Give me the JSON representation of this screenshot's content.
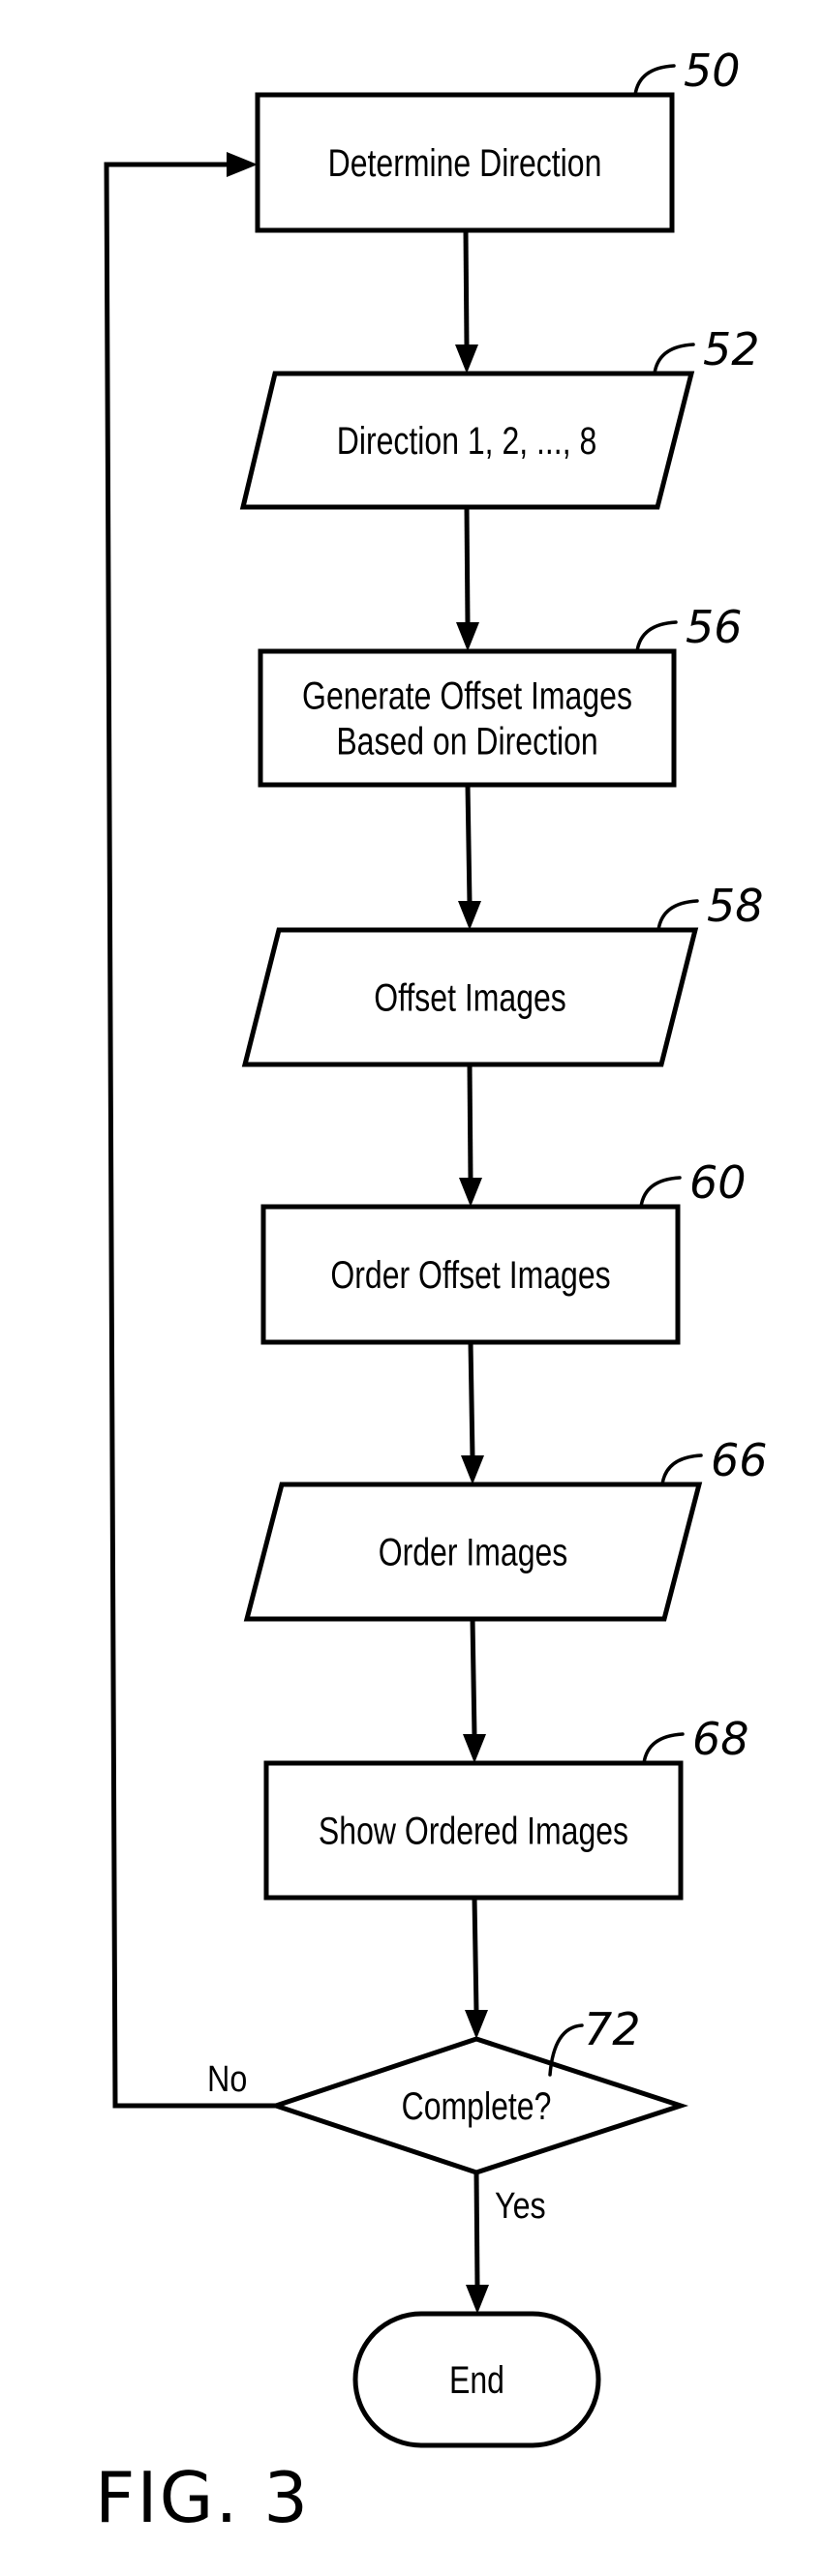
{
  "figure": {
    "caption": "FIG. 3",
    "type": "flowchart",
    "colors": {
      "ink": "#000000",
      "paper": "#ffffff"
    }
  },
  "nodes": [
    {
      "id": "50",
      "shape": "process",
      "ref": "50",
      "lines": [
        "Determine Direction"
      ]
    },
    {
      "id": "52",
      "shape": "data",
      "ref": "52",
      "lines": [
        "Direction 1, 2, ..., 8"
      ]
    },
    {
      "id": "56",
      "shape": "process",
      "ref": "56",
      "lines": [
        "Generate Offset Images",
        "Based on Direction"
      ]
    },
    {
      "id": "58",
      "shape": "data",
      "ref": "58",
      "lines": [
        "Offset Images"
      ]
    },
    {
      "id": "60",
      "shape": "process",
      "ref": "60",
      "lines": [
        "Order Offset Images"
      ]
    },
    {
      "id": "66",
      "shape": "data",
      "ref": "66",
      "lines": [
        "Order Images"
      ]
    },
    {
      "id": "68",
      "shape": "process",
      "ref": "68",
      "lines": [
        "Show Ordered Images"
      ]
    },
    {
      "id": "72",
      "shape": "decision",
      "ref": "72",
      "lines": [
        "Complete?"
      ]
    },
    {
      "id": "end",
      "shape": "terminator",
      "ref": "",
      "lines": [
        "End"
      ]
    }
  ],
  "edges": [
    {
      "from": "50",
      "to": "52",
      "label": ""
    },
    {
      "from": "52",
      "to": "56",
      "label": ""
    },
    {
      "from": "56",
      "to": "58",
      "label": ""
    },
    {
      "from": "58",
      "to": "60",
      "label": ""
    },
    {
      "from": "60",
      "to": "66",
      "label": ""
    },
    {
      "from": "66",
      "to": "68",
      "label": ""
    },
    {
      "from": "68",
      "to": "72",
      "label": ""
    },
    {
      "from": "72",
      "to": "end",
      "label": "Yes"
    },
    {
      "from": "72",
      "to": "50",
      "label": "No"
    }
  ]
}
